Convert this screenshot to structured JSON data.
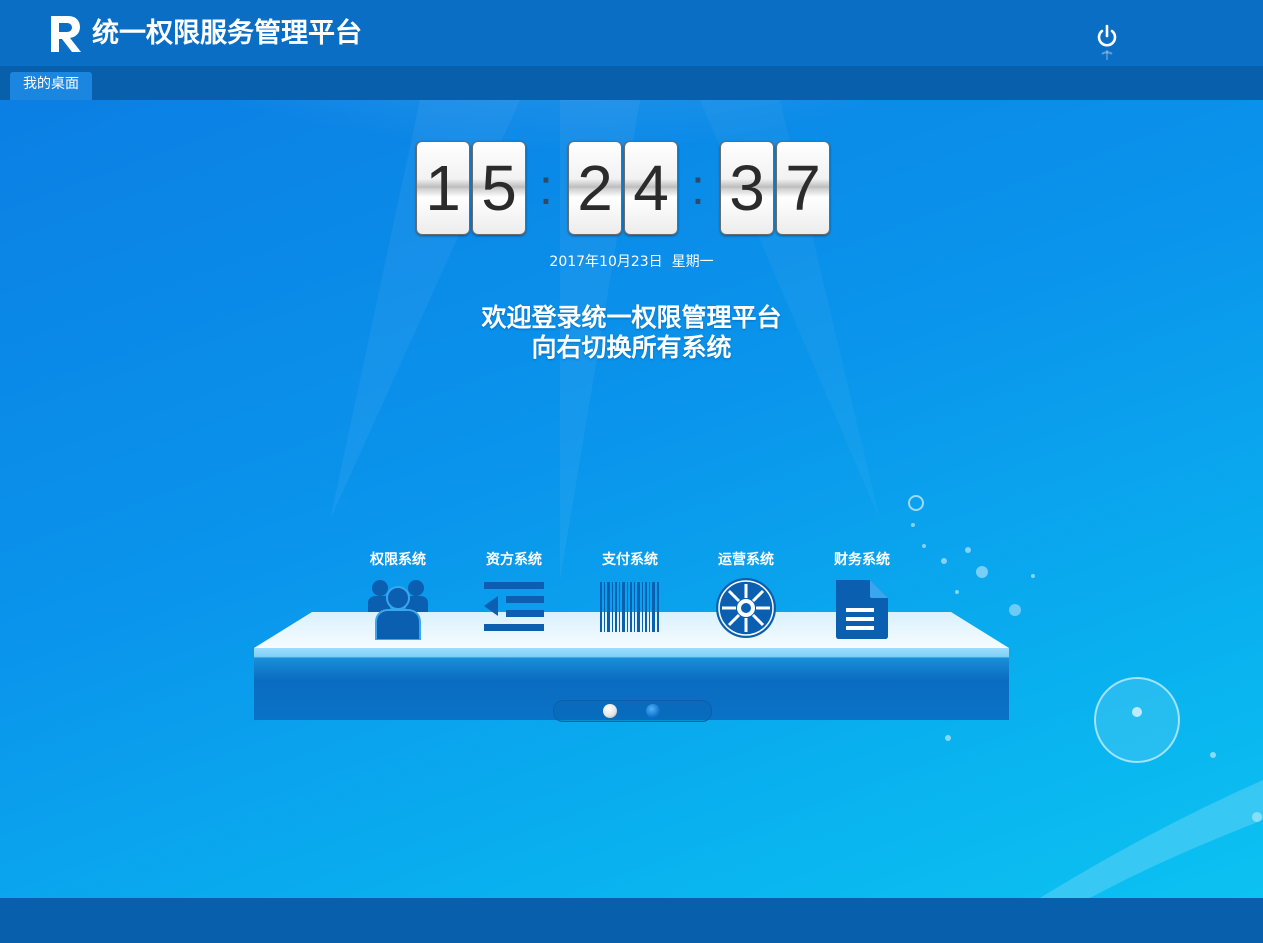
{
  "header": {
    "logo_letter": "R",
    "title": "统一权限服务管理平台",
    "power_icon": "power-icon"
  },
  "tabs": [
    {
      "label": "我的桌面",
      "active": true
    }
  ],
  "clock": {
    "h1": "1",
    "h2": "5",
    "m1": "2",
    "m2": "4",
    "s1": "3",
    "s2": "7",
    "separator": ":"
  },
  "date": "2017年10月23日  星期一",
  "welcome": {
    "line1": "欢迎登录统一权限管理平台",
    "line2": "向右切换所有系统"
  },
  "systems": [
    {
      "label": "权限系统",
      "icon": "users-icon"
    },
    {
      "label": "资方系统",
      "icon": "indent-list-icon"
    },
    {
      "label": "支付系统",
      "icon": "barcode-icon"
    },
    {
      "label": "运营系统",
      "icon": "empire-gear-icon"
    },
    {
      "label": "财务系统",
      "icon": "document-icon"
    }
  ],
  "pager": {
    "pages": 2,
    "current": 1
  },
  "colors": {
    "header": "#0a6ec5",
    "tabbar": "#0860ad",
    "tab_active": "#1a86e0",
    "icon_blue": "#0a5fb0",
    "background": "#0a95ec"
  }
}
